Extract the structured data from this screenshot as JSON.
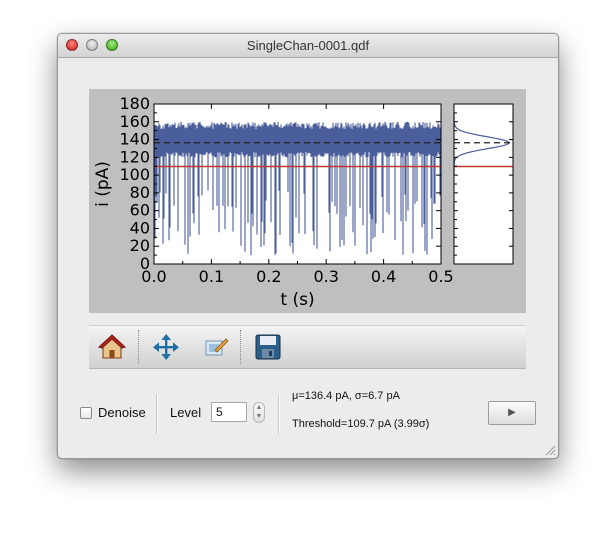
{
  "window": {
    "title": "SingleChan-0001.qdf"
  },
  "chart_data": [
    {
      "type": "line",
      "xlabel": "t (s)",
      "ylabel": "i (pA)",
      "xlim": [
        0.0,
        0.5
      ],
      "ylim": [
        0,
        180
      ],
      "xticks": [
        "0.0",
        "0.1",
        "0.2",
        "0.3",
        "0.4",
        "0.5"
      ],
      "yticks": [
        "0",
        "20",
        "40",
        "60",
        "80",
        "100",
        "120",
        "140",
        "160",
        "180"
      ],
      "series": [
        {
          "color": "#4a5e9b",
          "open_level": 136.4,
          "band": [
            120,
            160
          ],
          "closed_min": 10
        }
      ],
      "mean_line": {
        "value": 136.4,
        "style": "dashed",
        "color": "#222222"
      },
      "threshold_line": {
        "value": 109.7,
        "style": "solid",
        "color": "#c0392b"
      },
      "grid": false
    },
    {
      "type": "line",
      "ylim": [
        0,
        180
      ],
      "series": [
        {
          "shape": "gaussian",
          "mean": 136.4,
          "sigma": 6.7,
          "color": "#4a5e9b"
        }
      ],
      "mean_line": {
        "value": 136.4,
        "style": "dashed",
        "color": "#222222"
      },
      "threshold_line": {
        "value": 109.7,
        "style": "solid",
        "color": "#c0392b"
      }
    }
  ],
  "toolbar": {
    "buttons": [
      {
        "icon": "home-icon"
      },
      {
        "icon": "pan-icon"
      },
      {
        "icon": "configure-subplots-icon"
      },
      {
        "icon": "save-icon"
      }
    ]
  },
  "controls": {
    "denoise_label": "Denoise",
    "denoise_checked": false,
    "level_label": "Level",
    "level_value": "5",
    "stats_line1": "μ=136.4 pA, σ=6.7 pA",
    "stats_line2": "Threshold=109.7 pA (3.99σ)",
    "play_label": "▶"
  }
}
